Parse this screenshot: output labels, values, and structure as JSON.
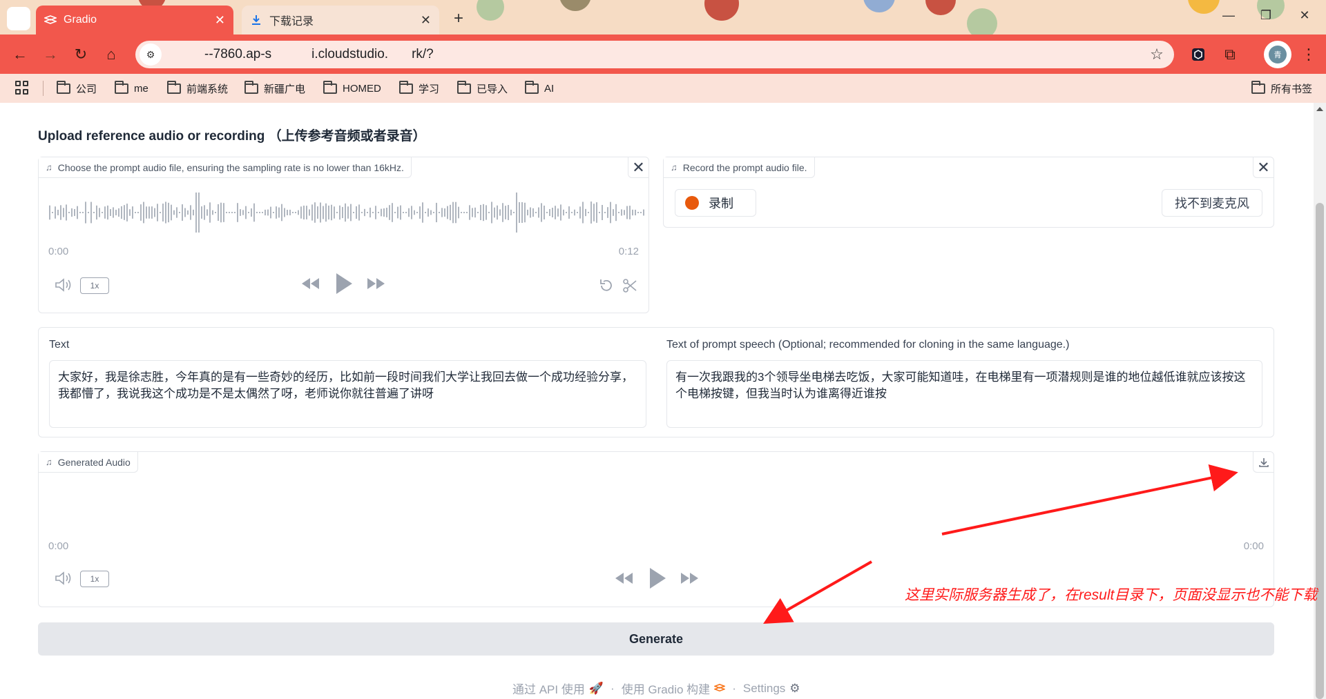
{
  "browser": {
    "tabs": [
      {
        "title": "Gradio",
        "active": true
      },
      {
        "title": "下载记录",
        "active": false
      }
    ],
    "url": "",
    "url_visible_fragments": [
      "--7860.ap-s",
      "i.cloudstudio.",
      "rk/?"
    ],
    "bookmarks": [
      "公司",
      "me",
      "前端系统",
      "新疆广电",
      "HOMED",
      "学习",
      "已导入",
      "AI"
    ],
    "all_bookmarks_label": "所有书签",
    "avatar_text": "青"
  },
  "page": {
    "section_title": "Upload reference audio or recording （上传参考音频或者录音）",
    "prompt_audio": {
      "label": "Choose the prompt audio file, ensuring the sampling rate is no lower than 16kHz.",
      "time_start": "0:00",
      "time_end": "0:12",
      "speed": "1x"
    },
    "record_audio": {
      "label": "Record the prompt audio file.",
      "record_button": "录制",
      "mic_button": "找不到麦克风"
    },
    "text_field": {
      "label": "Text",
      "value": "大家好，我是徐志胜，今年真的是有一些奇妙的经历，比如前一段时间我们大学让我回去做一个成功经验分享，我都懵了，我说我这个成功是不是太偶然了呀，老师说你就往普遍了讲呀"
    },
    "prompt_text_field": {
      "label": "Text of prompt speech (Optional; recommended for cloning in the same language.)",
      "value": "有一次我跟我的3个领导坐电梯去吃饭，大家可能知道哇，在电梯里有一项潜规则是谁的地位越低谁就应该按这个电梯按键，但我当时认为谁离得近谁按"
    },
    "generated_audio": {
      "label": "Generated Audio",
      "time_start": "0:00",
      "time_end": "0:00",
      "speed": "1x"
    },
    "generate_button": "Generate",
    "footer": {
      "api": "通过 API 使用",
      "built_with": "使用 Gradio 构建",
      "settings": "Settings"
    },
    "annotation": "这里实际服务器生成了，在result目录下，页面没显示也不能下载"
  },
  "colors": {
    "tab_active": "#f2574c",
    "record_dot": "#e8590c",
    "annotation": "#ff1a1a"
  }
}
